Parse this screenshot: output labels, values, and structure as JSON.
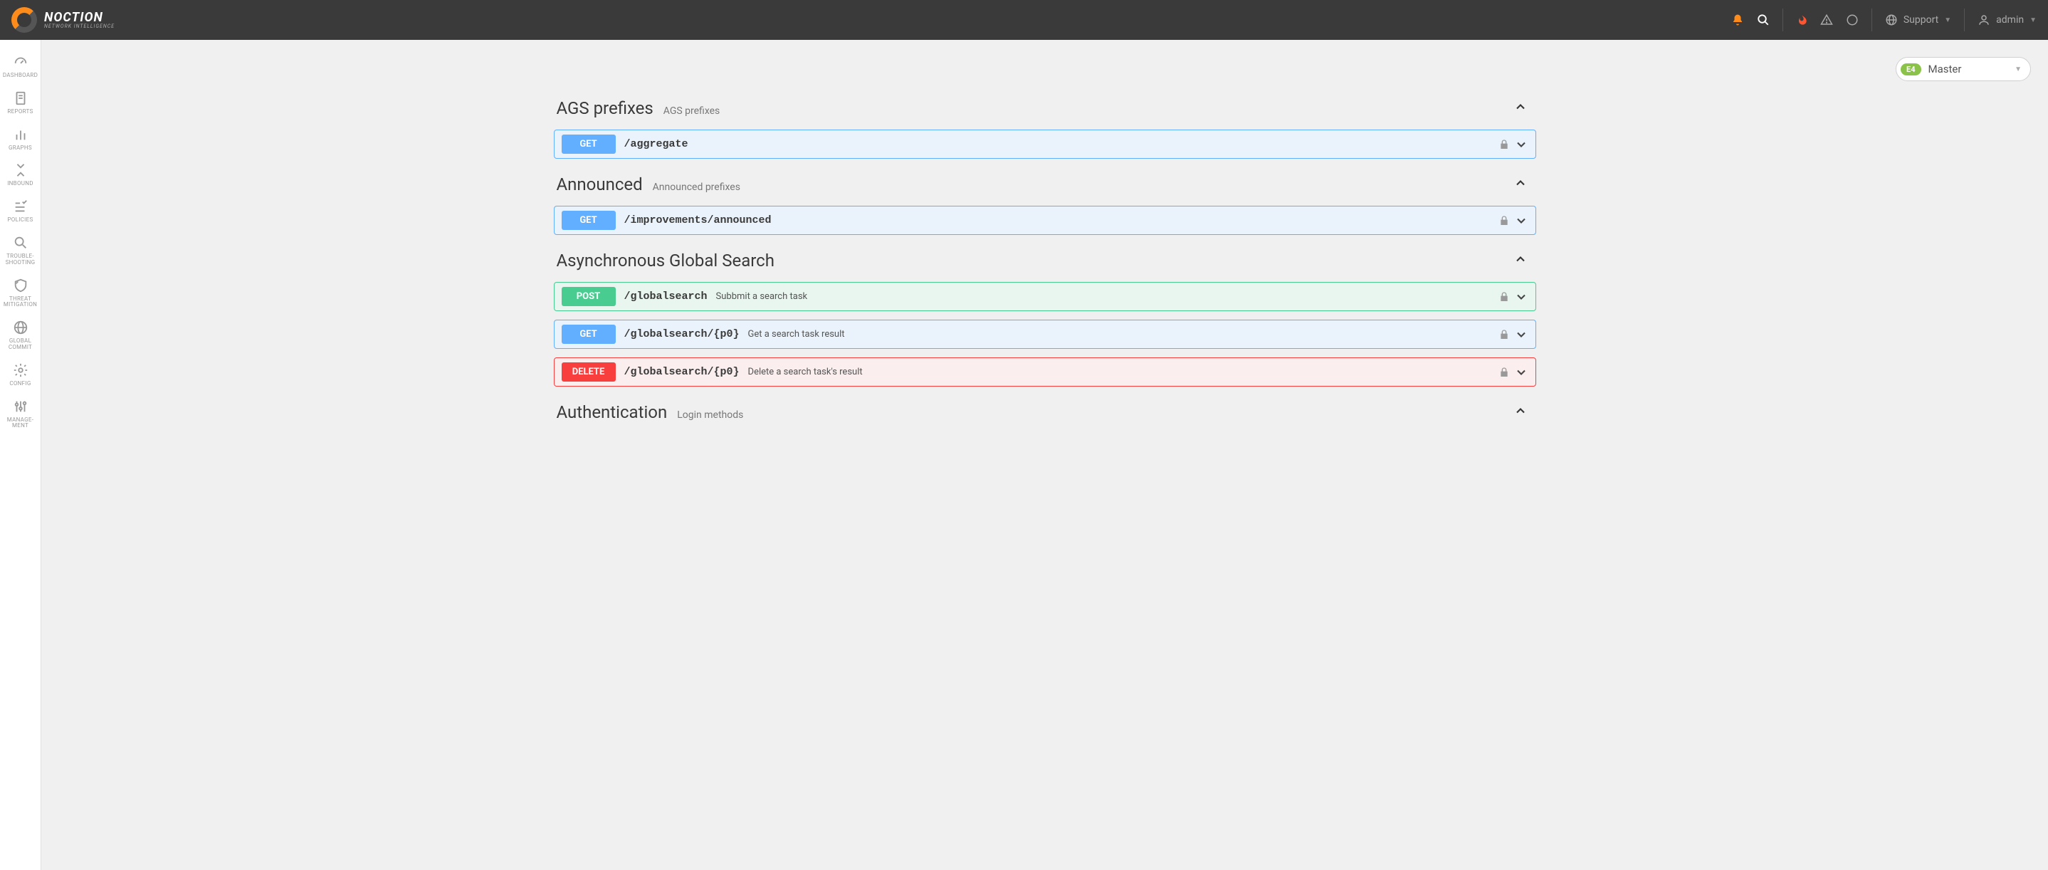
{
  "brand": {
    "name": "NOCTION",
    "tagline": "NETWORK INTELLIGENCE"
  },
  "header": {
    "support": "Support",
    "user": "admin"
  },
  "instance": {
    "badge": "E4",
    "label": "Master"
  },
  "sidebar": [
    {
      "label": "DASHBOARD"
    },
    {
      "label": "REPORTS"
    },
    {
      "label": "GRAPHS"
    },
    {
      "label": "INBOUND"
    },
    {
      "label": "POLICIES"
    },
    {
      "label": "TROUBLE-\nSHOOTING"
    },
    {
      "label": "THREAT\nMITIGATION"
    },
    {
      "label": "GLOBAL\nCOMMIT"
    },
    {
      "label": "CONFIG"
    },
    {
      "label": "MANAGE-\nMENT"
    }
  ],
  "sections": [
    {
      "title": "AGS prefixes",
      "subtitle": "AGS prefixes",
      "endpoints": [
        {
          "method": "GET",
          "path": "/aggregate",
          "desc": ""
        }
      ]
    },
    {
      "title": "Announced",
      "subtitle": "Announced prefixes",
      "endpoints": [
        {
          "method": "GET",
          "path": "/improvements/announced",
          "desc": ""
        }
      ]
    },
    {
      "title": "Asynchronous Global Search",
      "subtitle": "",
      "endpoints": [
        {
          "method": "POST",
          "path": "/globalsearch",
          "desc": "Subbmit a search task"
        },
        {
          "method": "GET",
          "path": "/globalsearch/{p0}",
          "desc": "Get a search task result"
        },
        {
          "method": "DELETE",
          "path": "/globalsearch/{p0}",
          "desc": "Delete a search task's result"
        }
      ]
    },
    {
      "title": "Authentication",
      "subtitle": "Login methods",
      "endpoints": []
    }
  ]
}
